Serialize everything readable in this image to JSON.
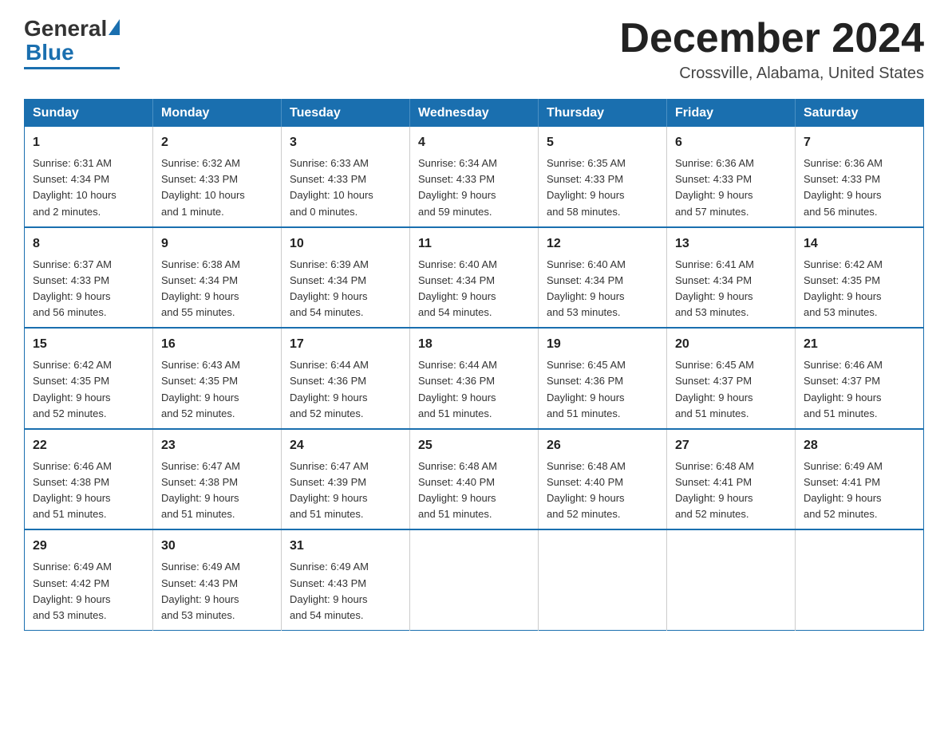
{
  "header": {
    "logo": {
      "general": "General",
      "blue": "Blue"
    },
    "title": "December 2024",
    "location": "Crossville, Alabama, United States"
  },
  "days_of_week": [
    "Sunday",
    "Monday",
    "Tuesday",
    "Wednesday",
    "Thursday",
    "Friday",
    "Saturday"
  ],
  "weeks": [
    [
      {
        "day": "1",
        "sunrise": "6:31 AM",
        "sunset": "4:34 PM",
        "daylight": "10 hours and 2 minutes."
      },
      {
        "day": "2",
        "sunrise": "6:32 AM",
        "sunset": "4:33 PM",
        "daylight": "10 hours and 1 minute."
      },
      {
        "day": "3",
        "sunrise": "6:33 AM",
        "sunset": "4:33 PM",
        "daylight": "10 hours and 0 minutes."
      },
      {
        "day": "4",
        "sunrise": "6:34 AM",
        "sunset": "4:33 PM",
        "daylight": "9 hours and 59 minutes."
      },
      {
        "day": "5",
        "sunrise": "6:35 AM",
        "sunset": "4:33 PM",
        "daylight": "9 hours and 58 minutes."
      },
      {
        "day": "6",
        "sunrise": "6:36 AM",
        "sunset": "4:33 PM",
        "daylight": "9 hours and 57 minutes."
      },
      {
        "day": "7",
        "sunrise": "6:36 AM",
        "sunset": "4:33 PM",
        "daylight": "9 hours and 56 minutes."
      }
    ],
    [
      {
        "day": "8",
        "sunrise": "6:37 AM",
        "sunset": "4:33 PM",
        "daylight": "9 hours and 56 minutes."
      },
      {
        "day": "9",
        "sunrise": "6:38 AM",
        "sunset": "4:34 PM",
        "daylight": "9 hours and 55 minutes."
      },
      {
        "day": "10",
        "sunrise": "6:39 AM",
        "sunset": "4:34 PM",
        "daylight": "9 hours and 54 minutes."
      },
      {
        "day": "11",
        "sunrise": "6:40 AM",
        "sunset": "4:34 PM",
        "daylight": "9 hours and 54 minutes."
      },
      {
        "day": "12",
        "sunrise": "6:40 AM",
        "sunset": "4:34 PM",
        "daylight": "9 hours and 53 minutes."
      },
      {
        "day": "13",
        "sunrise": "6:41 AM",
        "sunset": "4:34 PM",
        "daylight": "9 hours and 53 minutes."
      },
      {
        "day": "14",
        "sunrise": "6:42 AM",
        "sunset": "4:35 PM",
        "daylight": "9 hours and 53 minutes."
      }
    ],
    [
      {
        "day": "15",
        "sunrise": "6:42 AM",
        "sunset": "4:35 PM",
        "daylight": "9 hours and 52 minutes."
      },
      {
        "day": "16",
        "sunrise": "6:43 AM",
        "sunset": "4:35 PM",
        "daylight": "9 hours and 52 minutes."
      },
      {
        "day": "17",
        "sunrise": "6:44 AM",
        "sunset": "4:36 PM",
        "daylight": "9 hours and 52 minutes."
      },
      {
        "day": "18",
        "sunrise": "6:44 AM",
        "sunset": "4:36 PM",
        "daylight": "9 hours and 51 minutes."
      },
      {
        "day": "19",
        "sunrise": "6:45 AM",
        "sunset": "4:36 PM",
        "daylight": "9 hours and 51 minutes."
      },
      {
        "day": "20",
        "sunrise": "6:45 AM",
        "sunset": "4:37 PM",
        "daylight": "9 hours and 51 minutes."
      },
      {
        "day": "21",
        "sunrise": "6:46 AM",
        "sunset": "4:37 PM",
        "daylight": "9 hours and 51 minutes."
      }
    ],
    [
      {
        "day": "22",
        "sunrise": "6:46 AM",
        "sunset": "4:38 PM",
        "daylight": "9 hours and 51 minutes."
      },
      {
        "day": "23",
        "sunrise": "6:47 AM",
        "sunset": "4:38 PM",
        "daylight": "9 hours and 51 minutes."
      },
      {
        "day": "24",
        "sunrise": "6:47 AM",
        "sunset": "4:39 PM",
        "daylight": "9 hours and 51 minutes."
      },
      {
        "day": "25",
        "sunrise": "6:48 AM",
        "sunset": "4:40 PM",
        "daylight": "9 hours and 51 minutes."
      },
      {
        "day": "26",
        "sunrise": "6:48 AM",
        "sunset": "4:40 PM",
        "daylight": "9 hours and 52 minutes."
      },
      {
        "day": "27",
        "sunrise": "6:48 AM",
        "sunset": "4:41 PM",
        "daylight": "9 hours and 52 minutes."
      },
      {
        "day": "28",
        "sunrise": "6:49 AM",
        "sunset": "4:41 PM",
        "daylight": "9 hours and 52 minutes."
      }
    ],
    [
      {
        "day": "29",
        "sunrise": "6:49 AM",
        "sunset": "4:42 PM",
        "daylight": "9 hours and 53 minutes."
      },
      {
        "day": "30",
        "sunrise": "6:49 AM",
        "sunset": "4:43 PM",
        "daylight": "9 hours and 53 minutes."
      },
      {
        "day": "31",
        "sunrise": "6:49 AM",
        "sunset": "4:43 PM",
        "daylight": "9 hours and 54 minutes."
      },
      null,
      null,
      null,
      null
    ]
  ],
  "labels": {
    "sunrise": "Sunrise:",
    "sunset": "Sunset:",
    "daylight": "Daylight:"
  }
}
